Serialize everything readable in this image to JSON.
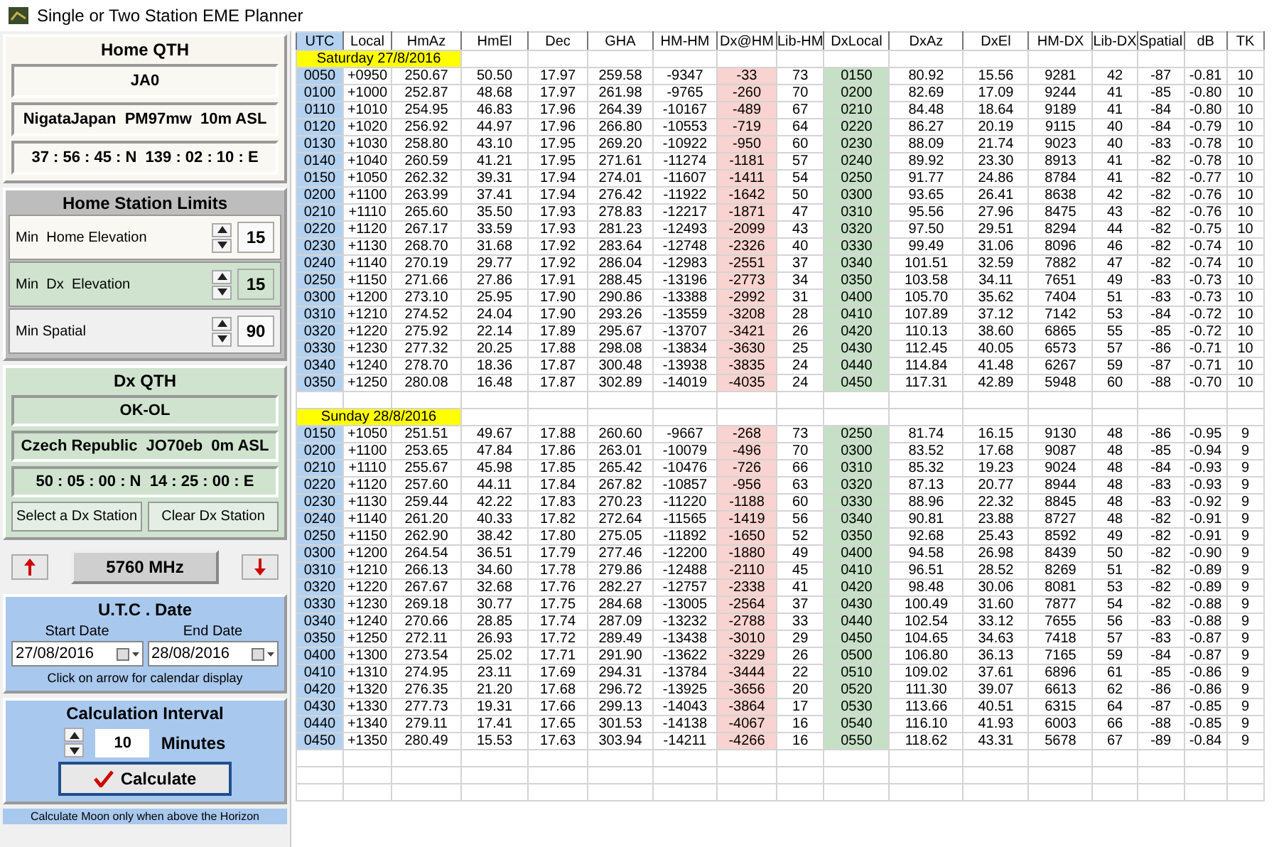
{
  "window": {
    "title": "Single or Two Station EME Planner"
  },
  "home_qth": {
    "title": "Home  QTH",
    "callsign": "JA0",
    "location": "NigataJapan  PM97mw  10m ASL",
    "coordinates": "37 : 56 : 45 : N  139 : 02 : 10 : E"
  },
  "home_limits": {
    "title": "Home Station Limits",
    "items": [
      {
        "label": "Min  Home Elevation",
        "value": "15",
        "kind": "home"
      },
      {
        "label": "Min  Dx  Elevation",
        "value": "15",
        "kind": "dx"
      },
      {
        "label": "Min Spatial",
        "value": "90",
        "kind": "plain"
      }
    ]
  },
  "dx_qth": {
    "title": "Dx  QTH",
    "callsign": "OK-OL",
    "location": "Czech Republic  JO70eb  0m ASL",
    "coordinates": "50 : 05 : 00 : N  14 : 25 : 00 : E",
    "buttons": [
      "Select a Dx Station",
      "Clear Dx Station"
    ]
  },
  "frequency": "5760 MHz",
  "utc_date": {
    "title": "U.T.C . Date",
    "start_label": "Start Date",
    "start": "27/08/2016",
    "end_label": "End Date",
    "end": "28/08/2016",
    "hint": "Click on arrow for calendar display"
  },
  "interval": {
    "title": "Calculation Interval",
    "value": "10",
    "unit": "Minutes",
    "button": "Calculate",
    "footer": "Calculate Moon only when above the Horizon"
  },
  "table": {
    "columns": [
      {
        "label": "UTC",
        "kind": "utc"
      },
      {
        "label": "Local",
        "kind": "plain"
      },
      {
        "label": "HmAz",
        "kind": "plain"
      },
      {
        "label": "HmEl",
        "kind": "plain"
      },
      {
        "label": "Dec",
        "kind": "plain"
      },
      {
        "label": "GHA",
        "kind": "plain"
      },
      {
        "label": "HM-HM",
        "kind": "plain"
      },
      {
        "label": "Dx@HM",
        "kind": "warn"
      },
      {
        "label": "Lib-HM",
        "kind": "plain"
      },
      {
        "label": "DxLocal",
        "kind": "dx"
      },
      {
        "label": "DxAz",
        "kind": "plain"
      },
      {
        "label": "DxEl",
        "kind": "plain"
      },
      {
        "label": "HM-DX",
        "kind": "plain"
      },
      {
        "label": "Lib-DX",
        "kind": "plain"
      },
      {
        "label": "Spatial",
        "kind": "plain"
      },
      {
        "label": "dB",
        "kind": "plain"
      },
      {
        "label": "TK",
        "kind": "plain"
      }
    ],
    "blocks": [
      {
        "date": "Saturday 27/8/2016",
        "rows": [
          [
            "0050",
            "+0950",
            "250.67",
            "50.50",
            "17.97",
            "259.58",
            "-9347",
            "-33",
            "73",
            "0150",
            "80.92",
            "15.56",
            "9281",
            "42",
            "-87",
            "-0.81",
            "10"
          ],
          [
            "0100",
            "+1000",
            "252.87",
            "48.68",
            "17.97",
            "261.98",
            "-9765",
            "-260",
            "70",
            "0200",
            "82.69",
            "17.09",
            "9244",
            "41",
            "-85",
            "-0.80",
            "10"
          ],
          [
            "0110",
            "+1010",
            "254.95",
            "46.83",
            "17.96",
            "264.39",
            "-10167",
            "-489",
            "67",
            "0210",
            "84.48",
            "18.64",
            "9189",
            "41",
            "-84",
            "-0.80",
            "10"
          ],
          [
            "0120",
            "+1020",
            "256.92",
            "44.97",
            "17.96",
            "266.80",
            "-10553",
            "-719",
            "64",
            "0220",
            "86.27",
            "20.19",
            "9115",
            "40",
            "-84",
            "-0.79",
            "10"
          ],
          [
            "0130",
            "+1030",
            "258.80",
            "43.10",
            "17.95",
            "269.20",
            "-10922",
            "-950",
            "60",
            "0230",
            "88.09",
            "21.74",
            "9023",
            "40",
            "-83",
            "-0.78",
            "10"
          ],
          [
            "0140",
            "+1040",
            "260.59",
            "41.21",
            "17.95",
            "271.61",
            "-11274",
            "-1181",
            "57",
            "0240",
            "89.92",
            "23.30",
            "8913",
            "41",
            "-82",
            "-0.78",
            "10"
          ],
          [
            "0150",
            "+1050",
            "262.32",
            "39.31",
            "17.94",
            "274.01",
            "-11607",
            "-1411",
            "54",
            "0250",
            "91.77",
            "24.86",
            "8784",
            "41",
            "-82",
            "-0.77",
            "10"
          ],
          [
            "0200",
            "+1100",
            "263.99",
            "37.41",
            "17.94",
            "276.42",
            "-11922",
            "-1642",
            "50",
            "0300",
            "93.65",
            "26.41",
            "8638",
            "42",
            "-82",
            "-0.76",
            "10"
          ],
          [
            "0210",
            "+1110",
            "265.60",
            "35.50",
            "17.93",
            "278.83",
            "-12217",
            "-1871",
            "47",
            "0310",
            "95.56",
            "27.96",
            "8475",
            "43",
            "-82",
            "-0.76",
            "10"
          ],
          [
            "0220",
            "+1120",
            "267.17",
            "33.59",
            "17.93",
            "281.23",
            "-12493",
            "-2099",
            "43",
            "0320",
            "97.50",
            "29.51",
            "8294",
            "44",
            "-82",
            "-0.75",
            "10"
          ],
          [
            "0230",
            "+1130",
            "268.70",
            "31.68",
            "17.92",
            "283.64",
            "-12748",
            "-2326",
            "40",
            "0330",
            "99.49",
            "31.06",
            "8096",
            "46",
            "-82",
            "-0.74",
            "10"
          ],
          [
            "0240",
            "+1140",
            "270.19",
            "29.77",
            "17.92",
            "286.04",
            "-12983",
            "-2551",
            "37",
            "0340",
            "101.51",
            "32.59",
            "7882",
            "47",
            "-82",
            "-0.74",
            "10"
          ],
          [
            "0250",
            "+1150",
            "271.66",
            "27.86",
            "17.91",
            "288.45",
            "-13196",
            "-2773",
            "34",
            "0350",
            "103.58",
            "34.11",
            "7651",
            "49",
            "-83",
            "-0.73",
            "10"
          ],
          [
            "0300",
            "+1200",
            "273.10",
            "25.95",
            "17.90",
            "290.86",
            "-13388",
            "-2992",
            "31",
            "0400",
            "105.70",
            "35.62",
            "7404",
            "51",
            "-83",
            "-0.73",
            "10"
          ],
          [
            "0310",
            "+1210",
            "274.52",
            "24.04",
            "17.90",
            "293.26",
            "-13559",
            "-3208",
            "28",
            "0410",
            "107.89",
            "37.12",
            "7142",
            "53",
            "-84",
            "-0.72",
            "10"
          ],
          [
            "0320",
            "+1220",
            "275.92",
            "22.14",
            "17.89",
            "295.67",
            "-13707",
            "-3421",
            "26",
            "0420",
            "110.13",
            "38.60",
            "6865",
            "55",
            "-85",
            "-0.72",
            "10"
          ],
          [
            "0330",
            "+1230",
            "277.32",
            "20.25",
            "17.88",
            "298.08",
            "-13834",
            "-3630",
            "25",
            "0430",
            "112.45",
            "40.05",
            "6573",
            "57",
            "-86",
            "-0.71",
            "10"
          ],
          [
            "0340",
            "+1240",
            "278.70",
            "18.36",
            "17.87",
            "300.48",
            "-13938",
            "-3835",
            "24",
            "0440",
            "114.84",
            "41.48",
            "6267",
            "59",
            "-87",
            "-0.71",
            "10"
          ],
          [
            "0350",
            "+1250",
            "280.08",
            "16.48",
            "17.87",
            "302.89",
            "-14019",
            "-4035",
            "24",
            "0450",
            "117.31",
            "42.89",
            "5948",
            "60",
            "-88",
            "-0.70",
            "10"
          ]
        ]
      },
      {
        "date": "Sunday 28/8/2016",
        "rows": [
          [
            "0150",
            "+1050",
            "251.51",
            "49.67",
            "17.88",
            "260.60",
            "-9667",
            "-268",
            "73",
            "0250",
            "81.74",
            "16.15",
            "9130",
            "48",
            "-86",
            "-0.95",
            "9"
          ],
          [
            "0200",
            "+1100",
            "253.65",
            "47.84",
            "17.86",
            "263.01",
            "-10079",
            "-496",
            "70",
            "0300",
            "83.52",
            "17.68",
            "9087",
            "48",
            "-85",
            "-0.94",
            "9"
          ],
          [
            "0210",
            "+1110",
            "255.67",
            "45.98",
            "17.85",
            "265.42",
            "-10476",
            "-726",
            "66",
            "0310",
            "85.32",
            "19.23",
            "9024",
            "48",
            "-84",
            "-0.93",
            "9"
          ],
          [
            "0220",
            "+1120",
            "257.60",
            "44.11",
            "17.84",
            "267.82",
            "-10857",
            "-956",
            "63",
            "0320",
            "87.13",
            "20.77",
            "8944",
            "48",
            "-83",
            "-0.93",
            "9"
          ],
          [
            "0230",
            "+1130",
            "259.44",
            "42.22",
            "17.83",
            "270.23",
            "-11220",
            "-1188",
            "60",
            "0330",
            "88.96",
            "22.32",
            "8845",
            "48",
            "-83",
            "-0.92",
            "9"
          ],
          [
            "0240",
            "+1140",
            "261.20",
            "40.33",
            "17.82",
            "272.64",
            "-11565",
            "-1419",
            "56",
            "0340",
            "90.81",
            "23.88",
            "8727",
            "48",
            "-82",
            "-0.91",
            "9"
          ],
          [
            "0250",
            "+1150",
            "262.90",
            "38.42",
            "17.80",
            "275.05",
            "-11892",
            "-1650",
            "52",
            "0350",
            "92.68",
            "25.43",
            "8592",
            "49",
            "-82",
            "-0.91",
            "9"
          ],
          [
            "0300",
            "+1200",
            "264.54",
            "36.51",
            "17.79",
            "277.46",
            "-12200",
            "-1880",
            "49",
            "0400",
            "94.58",
            "26.98",
            "8439",
            "50",
            "-82",
            "-0.90",
            "9"
          ],
          [
            "0310",
            "+1210",
            "266.13",
            "34.60",
            "17.78",
            "279.86",
            "-12488",
            "-2110",
            "45",
            "0410",
            "96.51",
            "28.52",
            "8269",
            "51",
            "-82",
            "-0.89",
            "9"
          ],
          [
            "0320",
            "+1220",
            "267.67",
            "32.68",
            "17.76",
            "282.27",
            "-12757",
            "-2338",
            "41",
            "0420",
            "98.48",
            "30.06",
            "8081",
            "53",
            "-82",
            "-0.89",
            "9"
          ],
          [
            "0330",
            "+1230",
            "269.18",
            "30.77",
            "17.75",
            "284.68",
            "-13005",
            "-2564",
            "37",
            "0430",
            "100.49",
            "31.60",
            "7877",
            "54",
            "-82",
            "-0.88",
            "9"
          ],
          [
            "0340",
            "+1240",
            "270.66",
            "28.85",
            "17.74",
            "287.09",
            "-13232",
            "-2788",
            "33",
            "0440",
            "102.54",
            "33.12",
            "7655",
            "56",
            "-83",
            "-0.88",
            "9"
          ],
          [
            "0350",
            "+1250",
            "272.11",
            "26.93",
            "17.72",
            "289.49",
            "-13438",
            "-3010",
            "29",
            "0450",
            "104.65",
            "34.63",
            "7418",
            "57",
            "-83",
            "-0.87",
            "9"
          ],
          [
            "0400",
            "+1300",
            "273.54",
            "25.02",
            "17.71",
            "291.90",
            "-13622",
            "-3229",
            "26",
            "0500",
            "106.80",
            "36.13",
            "7165",
            "59",
            "-84",
            "-0.87",
            "9"
          ],
          [
            "0410",
            "+1310",
            "274.95",
            "23.11",
            "17.69",
            "294.31",
            "-13784",
            "-3444",
            "22",
            "0510",
            "109.02",
            "37.61",
            "6896",
            "61",
            "-85",
            "-0.86",
            "9"
          ],
          [
            "0420",
            "+1320",
            "276.35",
            "21.20",
            "17.68",
            "296.72",
            "-13925",
            "-3656",
            "20",
            "0520",
            "111.30",
            "39.07",
            "6613",
            "62",
            "-86",
            "-0.86",
            "9"
          ],
          [
            "0430",
            "+1330",
            "277.73",
            "19.31",
            "17.66",
            "299.13",
            "-14043",
            "-3864",
            "17",
            "0530",
            "113.66",
            "40.51",
            "6315",
            "64",
            "-87",
            "-0.85",
            "9"
          ],
          [
            "0440",
            "+1340",
            "279.11",
            "17.41",
            "17.65",
            "301.53",
            "-14138",
            "-4067",
            "16",
            "0540",
            "116.10",
            "41.93",
            "6003",
            "66",
            "-88",
            "-0.85",
            "9"
          ],
          [
            "0450",
            "+1350",
            "280.49",
            "15.53",
            "17.63",
            "303.94",
            "-14211",
            "-4266",
            "16",
            "0550",
            "118.62",
            "43.31",
            "5678",
            "67",
            "-89",
            "-0.84",
            "9"
          ]
        ]
      }
    ]
  }
}
